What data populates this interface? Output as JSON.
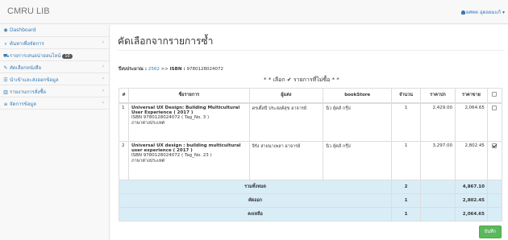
{
  "app": {
    "title": "CMRU LIB",
    "user": "ยศคต อุดอยมแก้"
  },
  "sidebar": {
    "items": [
      {
        "icon": "dashboard-icon",
        "glyph": "◉",
        "label": "Dashboard"
      },
      {
        "icon": "search-icon",
        "glyph": "⌕",
        "label": "ค้นหาเพื่อจัดการ"
      },
      {
        "icon": "cart-icon",
        "glyph": "⛟",
        "label": "รายการเสนอน่าออนไลน์",
        "badge": "10"
      },
      {
        "icon": "edit-icon",
        "glyph": "✎",
        "label": "คัดเลือกหนังสือ"
      },
      {
        "icon": "list-icon",
        "glyph": "☰",
        "label": "นำเข้าและส่งออกข้อมูล"
      },
      {
        "icon": "chart-icon",
        "glyph": "▥",
        "label": "รายงานการสั่งซื้อ"
      },
      {
        "icon": "menu-icon",
        "glyph": "≡",
        "label": "จัดการข้อมูล"
      }
    ],
    "chevron": "‹"
  },
  "main": {
    "title": "คัดเลือกจากรายการซ้ำ",
    "info": {
      "prefix": "ปีงบประมาณ : ",
      "year": "2562",
      "mid": " >> ",
      "isbn_label": "ISBN : ",
      "isbn": "9780128024072"
    },
    "subtitle": "* * เลือก ✔ รายการที่ไม่ซื้อ * *",
    "table": {
      "headers": [
        "#",
        "ชื่อรายการ",
        "ผู้แต่ง",
        "bookStore",
        "จำนวน",
        "ราคาปก",
        "ราคาขาย"
      ],
      "rows": [
        {
          "no": "1",
          "title": "Universal UX Design: Building Multicultural User Experience ( 2017 )",
          "isbn_line": "ISBN 9780128024072 ( Tag_No. 3 )",
          "lang": "ภาษาต่างประเทศ",
          "author": "ดรเติ้ลปี ประสงค์สุข อาจารย์",
          "store": "นิว ยุ้คส์ กรุ๊ป",
          "qty": "1",
          "cover_price": "2,429.00",
          "sale_price": "2,064.65",
          "checked": false
        },
        {
          "no": "2",
          "title": "Universal UX design : building multicultural user experience ( 2017 )",
          "isbn_line": "ISBN 9780128024072 ( Tag_No. 23 )",
          "lang": "ภาษาต่างประเทศ",
          "author": "จิรัง สายนาเพลา อาจารย์",
          "store": "นิว ยุ้คส์ กรุ๊ป",
          "qty": "1",
          "cover_price": "3,297.00",
          "sale_price": "2,802.45",
          "checked": true
        }
      ],
      "summary": [
        {
          "label": "รวมทั้งหมด",
          "qty": "2",
          "amount": "4,867.10"
        },
        {
          "label": "คัดออก",
          "qty": "1",
          "amount": "2,802.45"
        },
        {
          "label": "คงเหลือ",
          "qty": "1",
          "amount": "2,064.65"
        }
      ]
    },
    "save_label": "บันทึก"
  }
}
